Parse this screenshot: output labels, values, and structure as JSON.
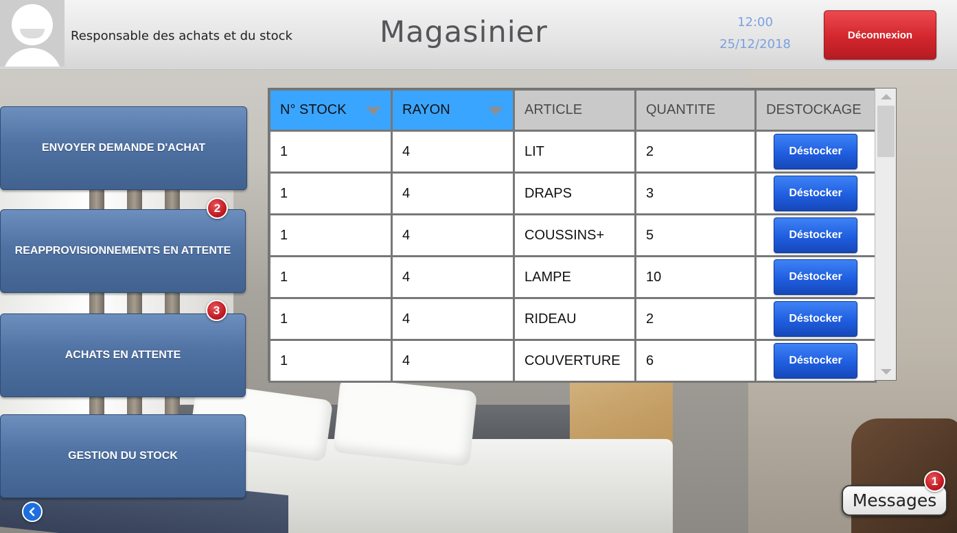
{
  "header": {
    "role": "Responsable des achats et du stock",
    "title": "Magasinier",
    "time": "12:00",
    "date": "25/12/2018",
    "logout_label": "Déconnexion"
  },
  "menu": {
    "items": [
      {
        "label": "ENVOYER DEMANDE D'ACHAT",
        "badge": null
      },
      {
        "label": "REAPPROVISIONNEMENTS EN ATTENTE",
        "badge": "2"
      },
      {
        "label": "ACHATS EN ATTENTE",
        "badge": "3"
      },
      {
        "label": "GESTION DU STOCK",
        "badge": null
      }
    ]
  },
  "table": {
    "columns": [
      "N° STOCK",
      "RAYON",
      "ARTICLE",
      "QUANTITE",
      "DESTOCKAGE"
    ],
    "action_label": "Déstocker",
    "rows": [
      {
        "stock": "1",
        "rayon": "4",
        "article": "LIT",
        "quantite": "2"
      },
      {
        "stock": "1",
        "rayon": "4",
        "article": "DRAPS",
        "quantite": "3"
      },
      {
        "stock": "1",
        "rayon": "4",
        "article": "COUSSINS+",
        "quantite": "5"
      },
      {
        "stock": "1",
        "rayon": "4",
        "article": "LAMPE",
        "quantite": "10"
      },
      {
        "stock": "1",
        "rayon": "4",
        "article": "RIDEAU",
        "quantite": "2"
      },
      {
        "stock": "1",
        "rayon": "4",
        "article": "COUVERTURE",
        "quantite": "6"
      }
    ]
  },
  "messages": {
    "label": "Messages",
    "badge": "1"
  },
  "icons": {
    "back": "chevron-left-icon",
    "sort": "sort-down-icon",
    "avatar": "user-avatar-icon"
  },
  "colors": {
    "accent_blue": "#3aa5ff",
    "menu_blue": "#4f72a3",
    "logout_red": "#d2262d",
    "badge_red": "#c21b23",
    "action_blue": "#1f5ee0",
    "clock_blue": "#7aa1e0"
  }
}
